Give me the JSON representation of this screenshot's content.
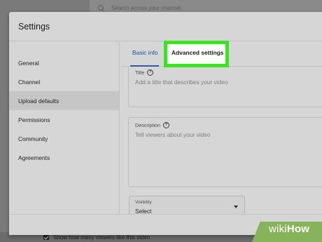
{
  "background": {
    "search_placeholder": "Search across your channel",
    "bottom_checkbox_label": "Show how many viewers like this video"
  },
  "dialog": {
    "title": "Settings",
    "sidebar": {
      "items": [
        {
          "label": "General",
          "active": false
        },
        {
          "label": "Channel",
          "active": false
        },
        {
          "label": "Upload defaults",
          "active": true
        },
        {
          "label": "Permissions",
          "active": false
        },
        {
          "label": "Community",
          "active": false
        },
        {
          "label": "Agreements",
          "active": false
        }
      ]
    },
    "tabs": {
      "basic_info": "Basic info",
      "advanced_settings": "Advanced settings",
      "active": "Basic info",
      "highlighted": "Advanced settings"
    },
    "title_field": {
      "label": "Title",
      "placeholder": "Add a title that describes your video"
    },
    "description_field": {
      "label": "Description",
      "placeholder": "Tell viewers about your video"
    },
    "visibility": {
      "label": "Visibility",
      "value": "Select"
    }
  },
  "watermark": {
    "wiki": "wiki",
    "how": "How"
  },
  "colors": {
    "highlight": "#39e51c",
    "tab_accent": "#2c5ab0",
    "wikihow_green": "#87b35a"
  },
  "icons": {
    "help": "question-circle-icon",
    "search": "search-icon",
    "dropdown": "caret-down-icon",
    "checkbox": "checkbox-checked-icon"
  }
}
